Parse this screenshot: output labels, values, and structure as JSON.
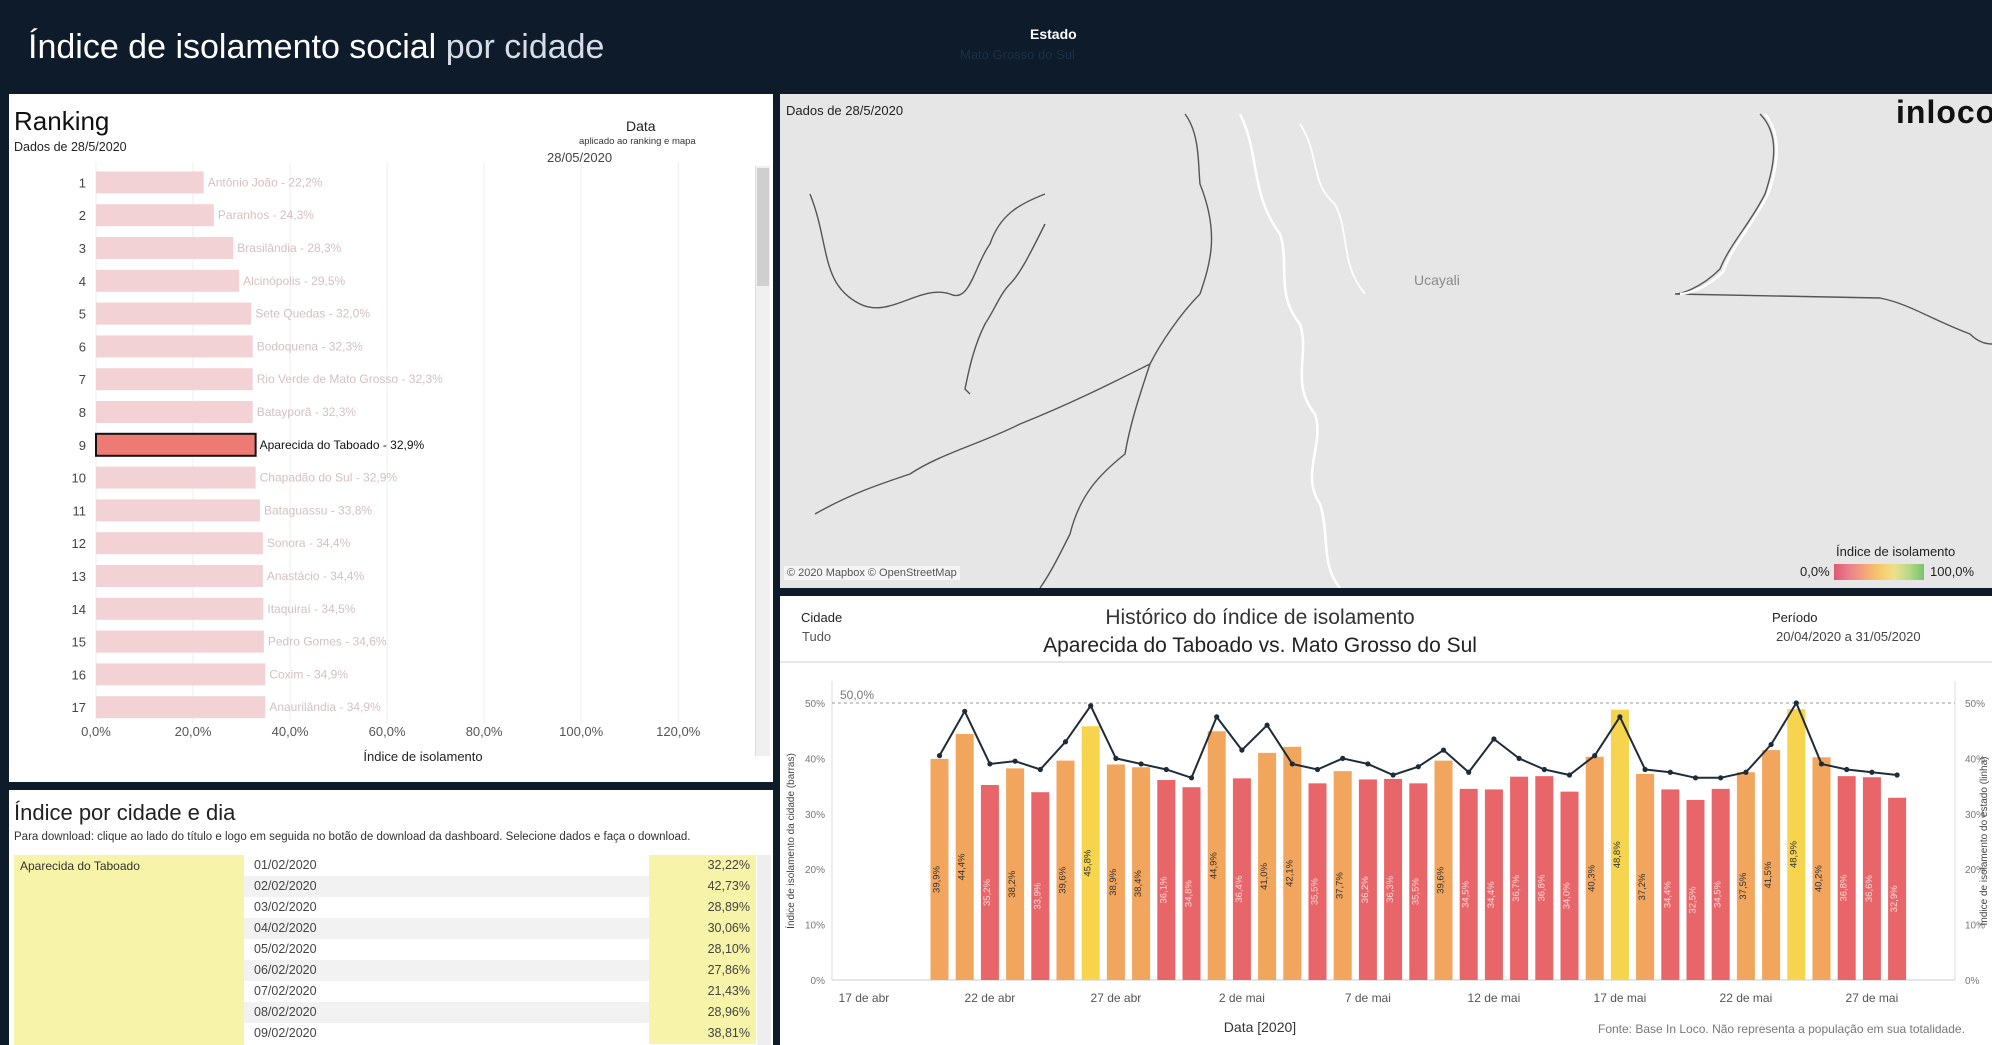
{
  "header": {
    "title_bold": "Índice de isolamento social",
    "title_light": "por cidade",
    "estado_label": "Estado",
    "estado_value": "Mato Grosso do Sul"
  },
  "ranking": {
    "title": "Ranking",
    "subtitle": "Dados de 28/5/2020",
    "date_label": "Data",
    "date_note": "aplicado ao ranking e mapa",
    "date_value": "28/05/2020"
  },
  "table": {
    "title": "Índice por cidade e dia",
    "note": "Para download: clique ao lado do título e logo em seguida no botão de download da dashboard. Selecione dados e faça o download.",
    "city": "Aparecida do Taboado",
    "rows": [
      {
        "date": "01/02/2020",
        "value": "32,22%"
      },
      {
        "date": "02/02/2020",
        "value": "42,73%"
      },
      {
        "date": "03/02/2020",
        "value": "28,89%"
      },
      {
        "date": "04/02/2020",
        "value": "30,06%"
      },
      {
        "date": "05/02/2020",
        "value": "28,10%"
      },
      {
        "date": "06/02/2020",
        "value": "27,86%"
      },
      {
        "date": "07/02/2020",
        "value": "21,43%"
      },
      {
        "date": "08/02/2020",
        "value": "28,96%"
      },
      {
        "date": "09/02/2020",
        "value": "38,81%"
      }
    ]
  },
  "map": {
    "date_text": "Dados de 28/5/2020",
    "brand": "inloco",
    "region_label": "Ucayali",
    "attribution": "© 2020 Mapbox © OpenStreetMap",
    "legend_title": "Índice de isolamento",
    "legend_min": "0,0%",
    "legend_max": "100,0%"
  },
  "history": {
    "cidade_label": "Cidade",
    "cidade_value": "Tudo",
    "periodo_label": "Período",
    "periodo_value": "20/04/2020 a 31/05/2020",
    "title": "Histórico do índice de isolamento",
    "subtitle": "Aparecida do Taboado vs. Mato Grosso do Sul",
    "source": "Fonte: Base In Loco. Não representa a população em sua totalidade."
  },
  "colors": {
    "header_bg": "#0d1b2a",
    "bar_low": "#e8666a",
    "bar_mid": "#f2a55c",
    "bar_high": "#f6d44e",
    "rank_faded": "#f2d2d4",
    "rank_selected": "#ee7a74",
    "line": "#1e2b38"
  },
  "chart_data": [
    {
      "type": "bar",
      "orientation": "horizontal",
      "ranks": [
        "1",
        "2",
        "3",
        "4",
        "5",
        "6",
        "7",
        "8",
        "9",
        "10",
        "11",
        "12",
        "13",
        "14",
        "15",
        "16",
        "17"
      ],
      "labels": [
        "Antônio João - 22,2%",
        "Paranhos - 24,3%",
        "Brasilândia - 28,3%",
        "Alcinópolis - 29,5%",
        "Sete Quedas - 32,0%",
        "Bodoquena - 32,3%",
        "Rio Verde de Mato Grosso - 32,3%",
        "Batayporã - 32,3%",
        "Aparecida do Taboado - 32,9%",
        "Chapadão do Sul - 32,9%",
        "Bataguassu - 33,8%",
        "Sonora - 34,4%",
        "Anastácio - 34,4%",
        "Itaquiraí - 34,5%",
        "Pedro Gomes - 34,6%",
        "Coxim - 34,9%",
        "Anaurilândia - 34,9%"
      ],
      "values": [
        22.2,
        24.3,
        28.3,
        29.5,
        32.0,
        32.3,
        32.3,
        32.3,
        32.9,
        32.9,
        33.8,
        34.4,
        34.4,
        34.5,
        34.6,
        34.9,
        34.9
      ],
      "highlight_index": 8,
      "xlabel": "Índice de isolamento",
      "xticks": [
        "0,0%",
        "20,0%",
        "40,0%",
        "60,0%",
        "80,0%",
        "100,0%",
        "120,0%"
      ],
      "xlim": [
        0,
        135
      ]
    },
    {
      "type": "bar",
      "x_ticks": [
        "17 de abr",
        "22 de abr",
        "27 de abr",
        "2 de mai",
        "7 de mai",
        "12 de mai",
        "17 de mai",
        "22 de mai",
        "27 de mai"
      ],
      "series": [
        {
          "name": "Aparecida do Taboado",
          "kind": "bar",
          "start_date": "20/04/2020",
          "values": [
            39.9,
            44.4,
            35.2,
            38.2,
            33.9,
            39.6,
            45.8,
            38.9,
            38.4,
            36.1,
            34.8,
            44.9,
            36.4,
            41.0,
            42.1,
            35.5,
            37.7,
            36.2,
            36.3,
            35.5,
            39.6,
            34.5,
            34.4,
            36.7,
            36.8,
            34.0,
            40.3,
            48.8,
            37.2,
            34.4,
            32.5,
            34.5,
            37.5,
            41.5,
            48.9,
            40.2,
            36.8,
            36.6,
            32.9
          ],
          "labels": [
            "39,9%",
            "44,4%",
            "35,2%",
            "38,2%",
            "33,9%",
            "39,6%",
            "45,8%",
            "38,9%",
            "38,4%",
            "36,1%",
            "34,8%",
            "44,9%",
            "36,4%",
            "41,0%",
            "42,1%",
            "35,5%",
            "37,7%",
            "36,2%",
            "36,3%",
            "35,5%",
            "39,6%",
            "34,5%",
            "34,4%",
            "36,7%",
            "36,8%",
            "34,0%",
            "40,3%",
            "48,8%",
            "37,2%",
            "34,4%",
            "32,5%",
            "34,5%",
            "37,5%",
            "41,5%",
            "48,9%",
            "40,2%",
            "36,8%",
            "36,6%",
            "32,9%"
          ]
        },
        {
          "name": "Mato Grosso do Sul",
          "kind": "line",
          "values": [
            40.5,
            48.5,
            39.0,
            39.5,
            38.0,
            43.0,
            49.5,
            40.0,
            39.0,
            38.0,
            36.5,
            47.5,
            41.5,
            46.0,
            39.0,
            38.0,
            40.0,
            39.0,
            37.0,
            38.5,
            41.5,
            37.5,
            43.5,
            40.0,
            38.0,
            37.0,
            40.5,
            47.5,
            38.0,
            37.5,
            36.5,
            36.5,
            37.5,
            42.5,
            50.0,
            39.0,
            38.0,
            37.5,
            37.0
          ]
        }
      ],
      "reference_line": {
        "value": 50,
        "label": "50,0%"
      },
      "y_left_label": "Índice de isolamento da cidade (barras)",
      "y_right_label": "Índice de isolamento do estado (linha)",
      "yticks": [
        "0%",
        "10%",
        "20%",
        "30%",
        "40%",
        "50%"
      ],
      "ylim": [
        0,
        50
      ],
      "xlabel": "Data [2020]"
    }
  ]
}
